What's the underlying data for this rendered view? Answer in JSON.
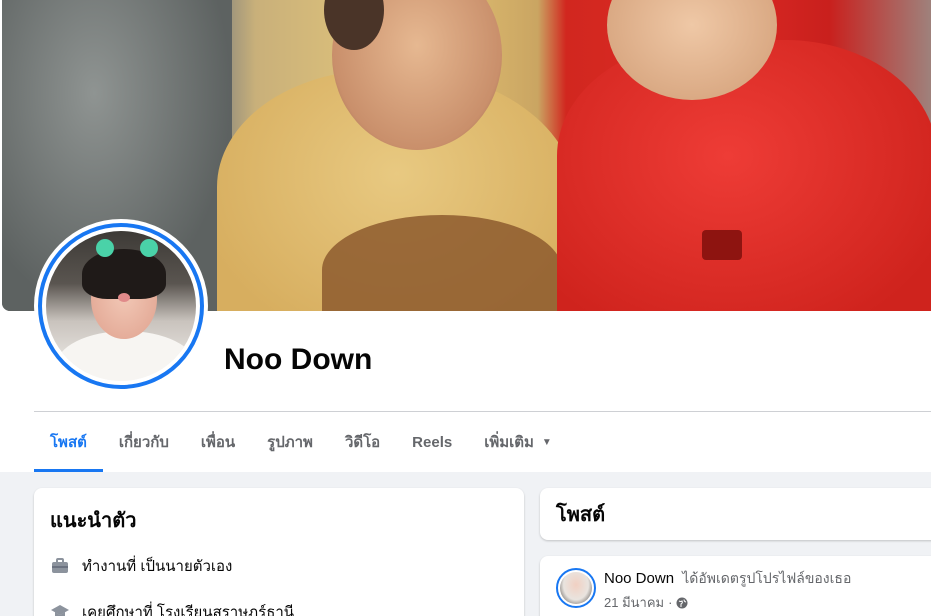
{
  "profile": {
    "name": "Noo Down"
  },
  "tabs": [
    {
      "label": "โพสต์",
      "active": true
    },
    {
      "label": "เกี่ยวกับ",
      "active": false
    },
    {
      "label": "เพื่อน",
      "active": false
    },
    {
      "label": "รูปภาพ",
      "active": false
    },
    {
      "label": "วิดีโอ",
      "active": false
    },
    {
      "label": "Reels",
      "active": false
    },
    {
      "label": "เพิ่มเติม",
      "active": false
    }
  ],
  "intro": {
    "title": "แนะนำตัว",
    "items": [
      {
        "icon": "briefcase-icon",
        "text": "ทำงานที่ เป็นนายตัวเอง"
      },
      {
        "icon": "graduation-cap-icon",
        "text": "เคยศึกษาที่ โรงเรียนสุราษฎร์ธานี"
      }
    ]
  },
  "posts_section": {
    "title": "โพสต์"
  },
  "post": {
    "author": "Noo Down",
    "action": "ได้อัพเดตรูปโปรไฟล์ของเธอ",
    "date": "21 มีนาคม",
    "separator": "·",
    "privacy_icon": "globe-icon"
  },
  "colors": {
    "accent": "#1877f2",
    "page_bg": "#f0f2f5",
    "secondary_text": "#65676b"
  }
}
